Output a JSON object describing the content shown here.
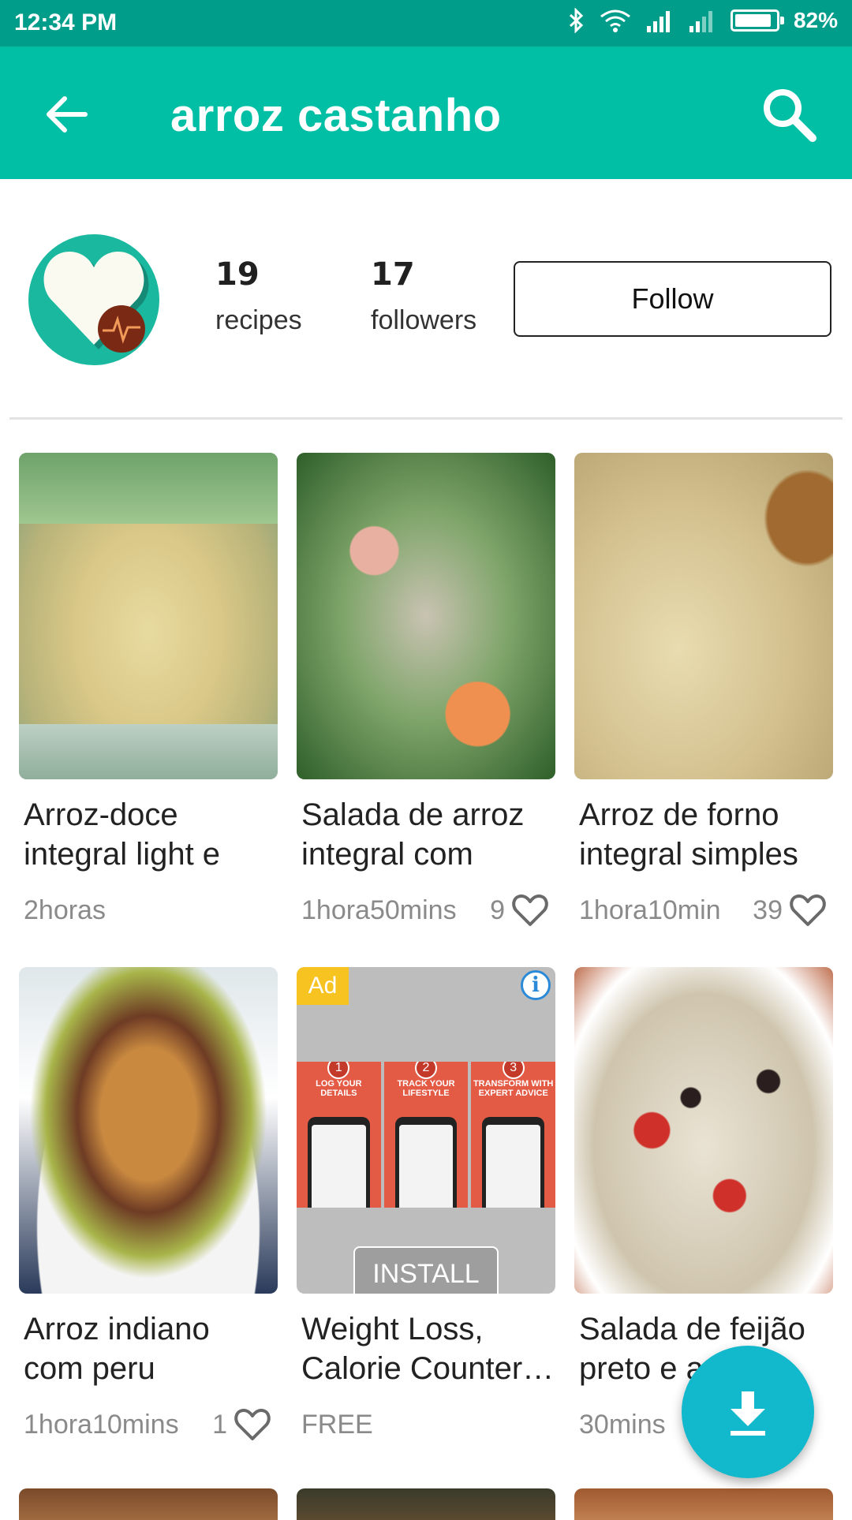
{
  "status_bar": {
    "time": "12:34 PM",
    "battery": "82%"
  },
  "app_bar": {
    "title": "arroz castanho",
    "back_icon": "arrow-left-icon",
    "search_icon": "search-icon"
  },
  "profile": {
    "recipes_count": "19",
    "recipes_label": "recipes",
    "followers_count": "17",
    "followers_label": "followers",
    "follow_label": "Follow"
  },
  "recipes": [
    {
      "title": "Arroz-doce integral light e",
      "time": "2horas",
      "likes": ""
    },
    {
      "title": "Salada de arroz integral com",
      "time": "1hora50mins",
      "likes": "9"
    },
    {
      "title": "Arroz de forno integral simples",
      "time": "1hora10min",
      "likes": "39"
    },
    {
      "title": "Arroz indiano com peru",
      "time": "1hora10mins",
      "likes": "1"
    },
    {
      "title": "Weight Loss, Calorie Counter…",
      "time": "FREE",
      "likes": ""
    },
    {
      "title": "Salada de feijão preto e a",
      "time": "30mins",
      "likes": ""
    }
  ],
  "ad": {
    "badge": "Ad",
    "info": "i",
    "install_label": "INSTALL",
    "panels": [
      {
        "num": "1",
        "caption": "LOG YOUR DETAILS"
      },
      {
        "num": "2",
        "caption": "TRACK YOUR LIFESTYLE"
      },
      {
        "num": "3",
        "caption": "TRANSFORM WITH EXPERT ADVICE"
      }
    ]
  },
  "colors": {
    "app_bar": "#00bfa5",
    "status_bar": "#009e8a",
    "fab": "#12b8cc"
  }
}
